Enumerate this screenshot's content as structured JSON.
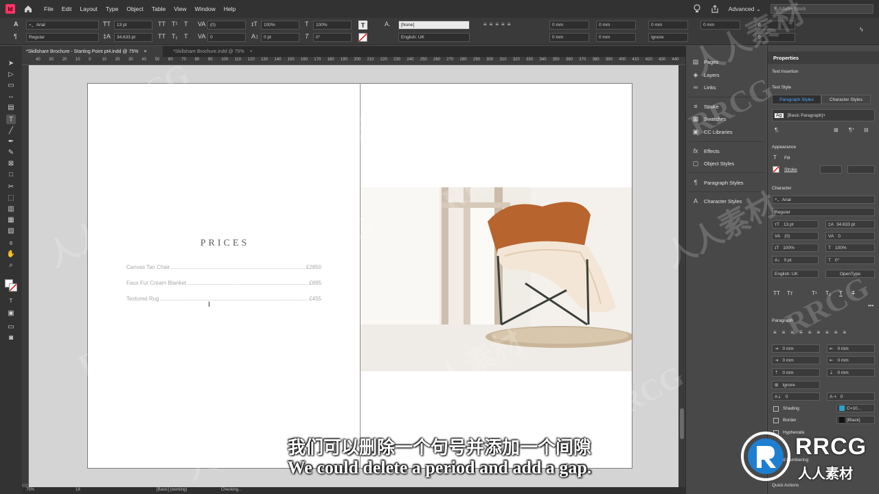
{
  "app": {
    "logo": "Id",
    "workspace": "Advanced",
    "stock_search_placeholder": "Adobe Stock"
  },
  "menu": [
    "File",
    "Edit",
    "Layout",
    "Type",
    "Object",
    "Table",
    "View",
    "Window",
    "Help"
  ],
  "control": {
    "font_family": "Arial",
    "font_style": "Regular",
    "font_size": "13 pt",
    "leading": "34.633 pt",
    "kerning": "(0)",
    "tracking": "0",
    "vscale": "100%",
    "hscale": "100%",
    "baseline": "0 pt",
    "skew": "0°",
    "style_tt": "TT",
    "style_tt2": "T¹",
    "style_tt3": "T",
    "style_tt4": "T₁",
    "style_tt5": "T",
    "char_style": "[None]",
    "language": "English: UK",
    "indent_left": "0 mm",
    "indent_right": "0 mm",
    "first_indent": "0 mm",
    "last_indent": "0 mm",
    "space_before": "0 mm",
    "space_after": "0 mm",
    "hyphen_zone": "Ignore",
    "drop_lines": "0",
    "drop_chars": "0"
  },
  "tabs": [
    {
      "label": "*Skillshare Brochure - Starting Point pt4.indd @ 75%",
      "close": "×"
    },
    {
      "label": "*Skillshare Brochure.indd @ 75%",
      "close": "×"
    }
  ],
  "ruler_labels": [
    "40",
    "30",
    "20",
    "10",
    "0",
    "10",
    "20",
    "30",
    "40",
    "50",
    "60",
    "70",
    "80",
    "90",
    "100",
    "110",
    "120",
    "130",
    "140",
    "150",
    "160",
    "170",
    "180",
    "190",
    "200",
    "210",
    "220",
    "230",
    "240",
    "250",
    "260",
    "270",
    "280",
    "290",
    "300",
    "310",
    "320",
    "330",
    "340",
    "350",
    "360",
    "370",
    "380",
    "390",
    "400",
    "410",
    "420",
    "430",
    "440"
  ],
  "page": {
    "title": "PRICES",
    "items": [
      {
        "name": "Canvas Tan Chair",
        "price": "£2850"
      },
      {
        "name": "Faux Fur Cream Blanket",
        "price": "£895"
      },
      {
        "name": "Textured Rug",
        "price": "£455"
      }
    ],
    "cursor": "I"
  },
  "panels": [
    {
      "icon": "pages-icon",
      "label": "Pages"
    },
    {
      "icon": "layers-icon",
      "label": "Layers"
    },
    {
      "icon": "links-icon",
      "label": "Links"
    },
    {
      "icon": "stroke-icon",
      "label": "Stroke"
    },
    {
      "icon": "swatches-icon",
      "label": "Swatches"
    },
    {
      "icon": "cc-libraries-icon",
      "label": "CC Libraries"
    },
    {
      "icon": "effects-icon",
      "label": "Effects"
    },
    {
      "icon": "object-styles-icon",
      "label": "Object Styles"
    },
    {
      "icon": "paragraph-styles-icon",
      "label": "Paragraph Styles"
    },
    {
      "icon": "character-styles-icon",
      "label": "Character Styles"
    }
  ],
  "properties": {
    "title": "Properties",
    "context": "Text Insertion",
    "text_style": "Text Style",
    "tab_paragraph": "Paragraph Styles",
    "tab_character": "Character Styles",
    "style_value": "[Basic Paragraph]+",
    "appearance": "Appearance",
    "fill": "Fill",
    "stroke": "Stroke",
    "character": "Character",
    "font_family": "Arial",
    "font_style": "Regular",
    "size": "13 pt",
    "leading": "34.633 pt",
    "kerning": "(0)",
    "tracking": "0",
    "vscale": "100%",
    "hscale": "100%",
    "baseline": "0 pt",
    "skew": "0°",
    "language": "English: UK",
    "opentype": "OpenType",
    "paragraph": "Paragraph",
    "left_indent": "0 mm",
    "right_indent": "0 mm",
    "first_indent": "0 mm",
    "last_indent": "0 mm",
    "space_before": "0 mm",
    "space_after": "0 mm",
    "align_grid": "Ignore",
    "drop_lines": "0",
    "drop_chars": "0",
    "shading": "Shading",
    "shading_value": "C=10...",
    "border": "Border",
    "border_value": "[Black]",
    "hyphenate": "Hyphenate",
    "numbering": "d Numbering",
    "quick_actions": "Quick Actions"
  },
  "status": {
    "zoom": "75%",
    "page": "18",
    "style": "[Basic] (working)",
    "preflight": "Checking..."
  },
  "subtitles": {
    "cn": "我们可以删除一个句号并添加一个间隙",
    "en": "We could delete a period and add a gap."
  },
  "watermark": {
    "en": "RRCG",
    "cn": "人人素材"
  },
  "colors": {
    "accent": "#ff3366",
    "tab_active": "#1473e6"
  }
}
